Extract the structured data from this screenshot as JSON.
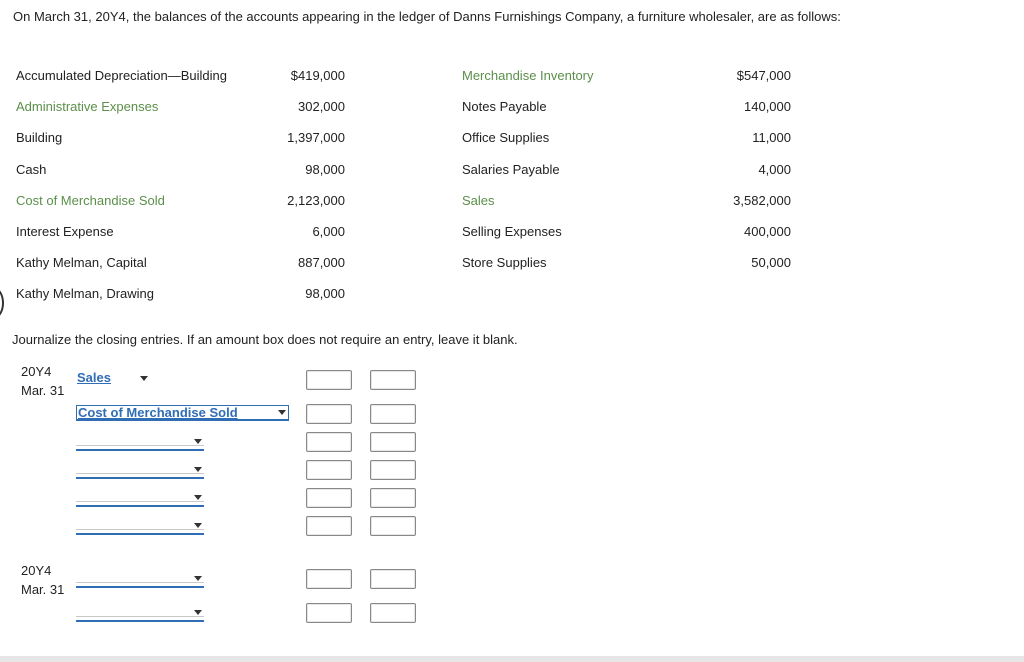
{
  "intro": "On March 31, 20Y4, the balances of the accounts appearing in the ledger of Danns Furnishings Company, a furniture wholesaler, are as follows:",
  "accounts_left": [
    {
      "name": "Accumulated Depreciation—Building",
      "amount": "$419,000",
      "linked": false
    },
    {
      "name": "Administrative Expenses",
      "amount": "302,000",
      "linked": true
    },
    {
      "name": "Building",
      "amount": "1,397,000",
      "linked": false
    },
    {
      "name": "Cash",
      "amount": "98,000",
      "linked": false
    },
    {
      "name": "Cost of Merchandise Sold",
      "amount": "2,123,000",
      "linked": true
    },
    {
      "name": "Interest Expense",
      "amount": "6,000",
      "linked": false
    },
    {
      "name": "Kathy Melman, Capital",
      "amount": "887,000",
      "linked": false
    },
    {
      "name": "Kathy Melman, Drawing",
      "amount": "98,000",
      "linked": false
    }
  ],
  "accounts_right": [
    {
      "name": "Merchandise Inventory",
      "amount": "$547,000",
      "linked": true
    },
    {
      "name": "Notes Payable",
      "amount": "140,000",
      "linked": false
    },
    {
      "name": "Office Supplies",
      "amount": "11,000",
      "linked": false
    },
    {
      "name": "Salaries Payable",
      "amount": "4,000",
      "linked": false
    },
    {
      "name": "Sales",
      "amount": "3,582,000",
      "linked": true
    },
    {
      "name": "Selling Expenses",
      "amount": "400,000",
      "linked": false
    },
    {
      "name": "Store Supplies",
      "amount": "50,000",
      "linked": false
    }
  ],
  "instruction": "Journalize the closing entries. If an amount box does not require an entry, leave it blank.",
  "entries": [
    {
      "year": "20Y4",
      "date": "Mar. 31"
    },
    {
      "year": "20Y4",
      "date": "Mar. 31"
    }
  ],
  "selects": {
    "row1": "Sales",
    "row2": "Cost of Merchandise Sold"
  },
  "colors": {
    "link_green": "#5b8f4a",
    "select_blue": "#2f6db5"
  }
}
